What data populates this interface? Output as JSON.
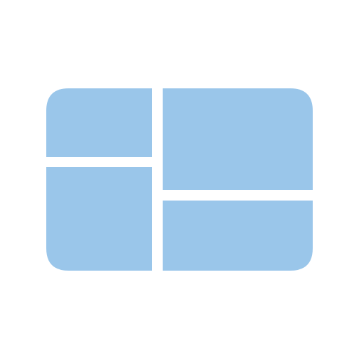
{
  "icon": {
    "name": "layout-grid-icon",
    "fill_color": "#9AC6EA",
    "background_color": "#FFFFFF"
  }
}
